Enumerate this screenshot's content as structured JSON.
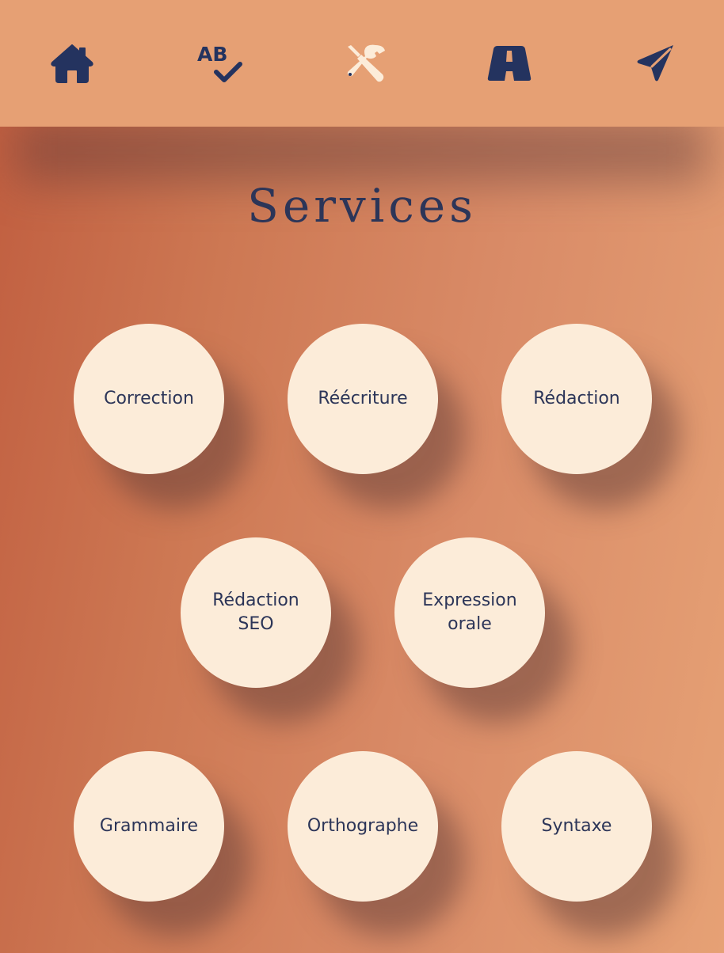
{
  "nav": {
    "items": [
      {
        "icon": "home-icon",
        "active": false
      },
      {
        "icon": "spell-check-icon",
        "active": false
      },
      {
        "icon": "tools-icon",
        "active": true
      },
      {
        "icon": "road-icon",
        "active": false
      },
      {
        "icon": "paper-plane-icon",
        "active": false
      }
    ]
  },
  "page": {
    "title": "Services"
  },
  "services": [
    {
      "label": "Correction"
    },
    {
      "label": "Réécriture"
    },
    {
      "label": "Rédaction"
    },
    {
      "label": "Rédaction\nSEO"
    },
    {
      "label": "Expression\norale"
    },
    {
      "label": "Grammaire"
    },
    {
      "label": "Orthographe"
    },
    {
      "label": "Syntaxe"
    }
  ],
  "colors": {
    "navbar_bg": "#e6a074",
    "icon_dark": "#24335f",
    "icon_active": "#fcecd9",
    "circle_bg": "#fcecd9",
    "text": "#2c3558",
    "gradient_start": "#c05d3f",
    "gradient_end": "#e6a175"
  }
}
